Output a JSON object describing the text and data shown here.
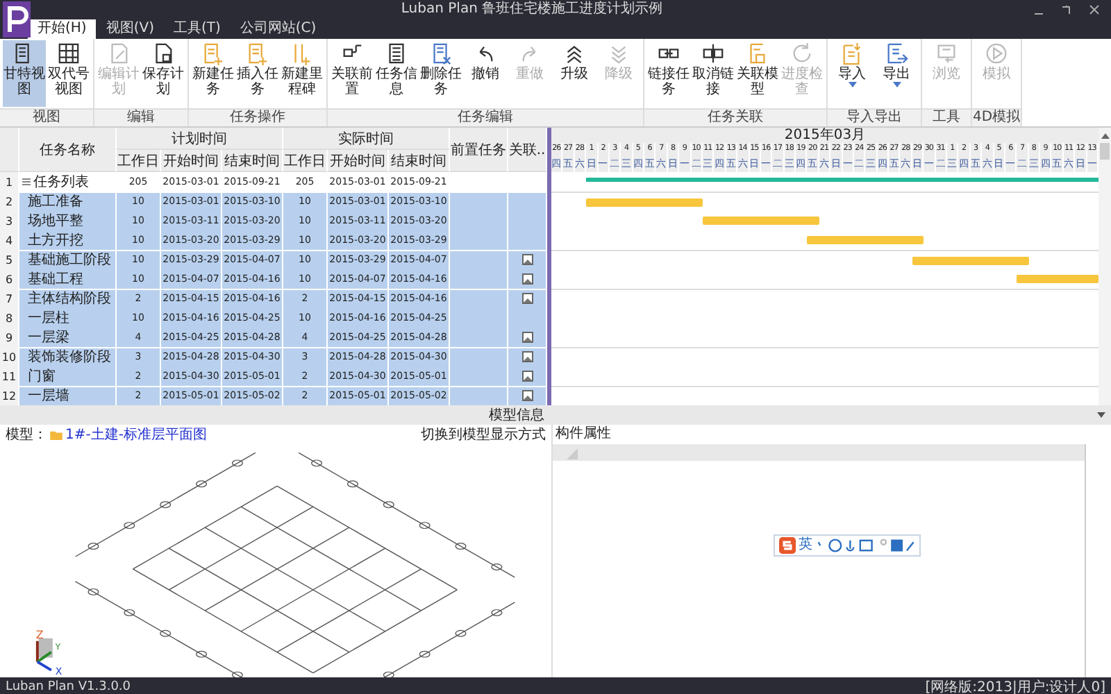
{
  "window": {
    "title": "Luban Plan 鲁班住宅楼施工进度计划示例"
  },
  "menu_tabs": [
    {
      "label": "开始(H)",
      "selected": true
    },
    {
      "label": "视图(V)",
      "selected": false
    },
    {
      "label": "工具(T)",
      "selected": false
    },
    {
      "label": "公司网站(C)",
      "selected": false
    }
  ],
  "ribbon": {
    "groups": [
      {
        "label": "视图",
        "buttons": [
          {
            "label": "甘特视图",
            "selected": true,
            "disabled": false
          },
          {
            "label": "双代号视图",
            "selected": false,
            "disabled": false
          }
        ]
      },
      {
        "label": "编辑",
        "buttons": [
          {
            "label": "编辑计划",
            "disabled": true
          },
          {
            "label": "保存计划",
            "disabled": false
          }
        ]
      },
      {
        "label": "任务操作",
        "buttons": [
          {
            "label": "新建任务",
            "disabled": false
          },
          {
            "label": "插入任务",
            "disabled": false
          },
          {
            "label": "新建里程碑",
            "disabled": false
          }
        ]
      },
      {
        "label": "任务编辑",
        "buttons": [
          {
            "label": "关联前置",
            "disabled": false
          },
          {
            "label": "任务信息",
            "disabled": false
          },
          {
            "label": "删除任务",
            "disabled": false
          },
          {
            "label": "撤销",
            "disabled": false
          },
          {
            "label": "重做",
            "disabled": true
          },
          {
            "label": "升级",
            "disabled": false
          },
          {
            "label": "降级",
            "disabled": true
          }
        ]
      },
      {
        "label": "任务关联",
        "buttons": [
          {
            "label": "链接任务",
            "disabled": false
          },
          {
            "label": "取消链接",
            "disabled": false
          },
          {
            "label": "关联模型",
            "disabled": false
          },
          {
            "label": "进度检查",
            "disabled": true
          }
        ]
      },
      {
        "label": "导入导出",
        "buttons": [
          {
            "label": "导入",
            "disabled": false,
            "dropdown": true
          },
          {
            "label": "导出",
            "disabled": false,
            "dropdown": true
          }
        ]
      },
      {
        "label": "工具",
        "buttons": [
          {
            "label": "浏览",
            "disabled": true
          }
        ]
      },
      {
        "label": "4D模拟",
        "buttons": [
          {
            "label": "模拟",
            "disabled": true
          }
        ]
      }
    ]
  },
  "table": {
    "columns": {
      "name": "任务名称",
      "plan": "计划时间",
      "actual": "实际时间",
      "sub": [
        "工作日",
        "开始时间",
        "结束时间",
        "工作日",
        "开始时间",
        "结束时间"
      ],
      "predecessor": "前置任务",
      "link": "关联.."
    },
    "rows": [
      {
        "num": "1",
        "name": "任务列表",
        "kind": "summary",
        "selected": false,
        "group_start": false,
        "linked": false,
        "plan_days": "205",
        "plan_start": "2015-03-01",
        "plan_end": "2015-09-21",
        "act_days": "205",
        "act_start": "2015-03-01",
        "act_end": "2015-09-21"
      },
      {
        "num": "2",
        "name": "施工准备",
        "kind": "task",
        "selected": true,
        "group_start": true,
        "linked": false,
        "plan_days": "10",
        "plan_start": "2015-03-01",
        "plan_end": "2015-03-10",
        "act_days": "10",
        "act_start": "2015-03-01",
        "act_end": "2015-03-10"
      },
      {
        "num": "3",
        "name": "场地平整",
        "kind": "task",
        "selected": true,
        "group_start": false,
        "linked": false,
        "plan_days": "10",
        "plan_start": "2015-03-11",
        "plan_end": "2015-03-20",
        "act_days": "10",
        "act_start": "2015-03-11",
        "act_end": "2015-03-20"
      },
      {
        "num": "4",
        "name": "土方开挖",
        "kind": "task",
        "selected": true,
        "group_start": false,
        "linked": false,
        "plan_days": "10",
        "plan_start": "2015-03-20",
        "plan_end": "2015-03-29",
        "act_days": "10",
        "act_start": "2015-03-20",
        "act_end": "2015-03-29"
      },
      {
        "num": "5",
        "name": "基础施工阶段",
        "kind": "task",
        "selected": true,
        "group_start": true,
        "linked": true,
        "plan_days": "10",
        "plan_start": "2015-03-29",
        "plan_end": "2015-04-07",
        "act_days": "10",
        "act_start": "2015-03-29",
        "act_end": "2015-04-07"
      },
      {
        "num": "6",
        "name": "基础工程",
        "kind": "task",
        "selected": true,
        "group_start": false,
        "linked": true,
        "plan_days": "10",
        "plan_start": "2015-04-07",
        "plan_end": "2015-04-16",
        "act_days": "10",
        "act_start": "2015-04-07",
        "act_end": "2015-04-16"
      },
      {
        "num": "7",
        "name": "主体结构阶段",
        "kind": "task",
        "selected": true,
        "group_start": true,
        "linked": true,
        "plan_days": "2",
        "plan_start": "2015-04-15",
        "plan_end": "2015-04-16",
        "act_days": "2",
        "act_start": "2015-04-15",
        "act_end": "2015-04-16"
      },
      {
        "num": "8",
        "name": "一层柱",
        "kind": "task",
        "selected": true,
        "group_start": false,
        "linked": false,
        "plan_days": "10",
        "plan_start": "2015-04-16",
        "plan_end": "2015-04-25",
        "act_days": "10",
        "act_start": "2015-04-16",
        "act_end": "2015-04-25"
      },
      {
        "num": "9",
        "name": "一层梁",
        "kind": "task",
        "selected": true,
        "group_start": false,
        "linked": true,
        "plan_days": "4",
        "plan_start": "2015-04-25",
        "plan_end": "2015-04-28",
        "act_days": "4",
        "act_start": "2015-04-25",
        "act_end": "2015-04-28"
      },
      {
        "num": "10",
        "name": "装饰装修阶段",
        "kind": "task",
        "selected": true,
        "group_start": true,
        "linked": true,
        "plan_days": "3",
        "plan_start": "2015-04-28",
        "plan_end": "2015-04-30",
        "act_days": "3",
        "act_start": "2015-04-28",
        "act_end": "2015-04-30"
      },
      {
        "num": "11",
        "name": "门窗",
        "kind": "task",
        "selected": true,
        "group_start": false,
        "linked": true,
        "plan_days": "2",
        "plan_start": "2015-04-30",
        "plan_end": "2015-05-01",
        "act_days": "2",
        "act_start": "2015-04-30",
        "act_end": "2015-05-01"
      },
      {
        "num": "12",
        "name": "一层墙",
        "kind": "task",
        "selected": true,
        "group_start": true,
        "linked": true,
        "plan_days": "2",
        "plan_start": "2015-05-01",
        "plan_end": "2015-05-02",
        "act_days": "2",
        "act_start": "2015-05-01",
        "act_end": "2015-05-02"
      }
    ]
  },
  "gantt": {
    "month": "2015年03月",
    "days": [
      {
        "day": "26",
        "weekday": "四"
      },
      {
        "day": "27",
        "weekday": "五"
      },
      {
        "day": "28",
        "weekday": "六"
      },
      {
        "day": "1",
        "weekday": "日"
      },
      {
        "day": "2",
        "weekday": "一"
      },
      {
        "day": "3",
        "weekday": "二"
      },
      {
        "day": "4",
        "weekday": "三"
      },
      {
        "day": "5",
        "weekday": "四"
      },
      {
        "day": "6",
        "weekday": "五"
      },
      {
        "day": "7",
        "weekday": "六"
      },
      {
        "day": "8",
        "weekday": "日"
      },
      {
        "day": "9",
        "weekday": "一"
      },
      {
        "day": "10",
        "weekday": "二"
      },
      {
        "day": "11",
        "weekday": "三"
      },
      {
        "day": "12",
        "weekday": "四"
      },
      {
        "day": "13",
        "weekday": "五"
      },
      {
        "day": "14",
        "weekday": "六"
      },
      {
        "day": "15",
        "weekday": "日"
      },
      {
        "day": "16",
        "weekday": "一"
      },
      {
        "day": "17",
        "weekday": "二"
      },
      {
        "day": "18",
        "weekday": "三"
      },
      {
        "day": "19",
        "weekday": "四"
      },
      {
        "day": "20",
        "weekday": "五"
      },
      {
        "day": "21",
        "weekday": "六"
      },
      {
        "day": "22",
        "weekday": "日"
      },
      {
        "day": "23",
        "weekday": "一"
      },
      {
        "day": "24",
        "weekday": "二"
      },
      {
        "day": "25",
        "weekday": "三"
      },
      {
        "day": "26",
        "weekday": "四"
      },
      {
        "day": "27",
        "weekday": "五"
      },
      {
        "day": "28",
        "weekday": "六"
      },
      {
        "day": "29",
        "weekday": "日"
      },
      {
        "day": "30",
        "weekday": "一"
      },
      {
        "day": "31",
        "weekday": "二"
      },
      {
        "day": "1",
        "weekday": "三"
      },
      {
        "day": "2",
        "weekday": "四"
      },
      {
        "day": "3",
        "weekday": "五"
      },
      {
        "day": "4",
        "weekday": "六"
      },
      {
        "day": "5",
        "weekday": "日"
      },
      {
        "day": "6",
        "weekday": "一"
      },
      {
        "day": "7",
        "weekday": "二"
      },
      {
        "day": "8",
        "weekday": "三"
      },
      {
        "day": "9",
        "weekday": "四"
      },
      {
        "day": "10",
        "weekday": "五"
      },
      {
        "day": "11",
        "weekday": "六"
      },
      {
        "day": "12",
        "weekday": "日"
      },
      {
        "day": "13",
        "weekday": "一"
      }
    ]
  },
  "model_pane": {
    "header": "模型信息",
    "label": "模型：",
    "model_link": "1#-土建-标准层平面图",
    "switch_link": "切换到模型显示方式",
    "axes": [
      "Z",
      "Y",
      "X"
    ]
  },
  "property_pane": {
    "label": "构件属性"
  },
  "ime_toolbar": {
    "mode": "英"
  },
  "status_bar": {
    "version": "Luban Plan V1.3.0.0",
    "user": "[网络版:2013|用户:设计人0]"
  }
}
